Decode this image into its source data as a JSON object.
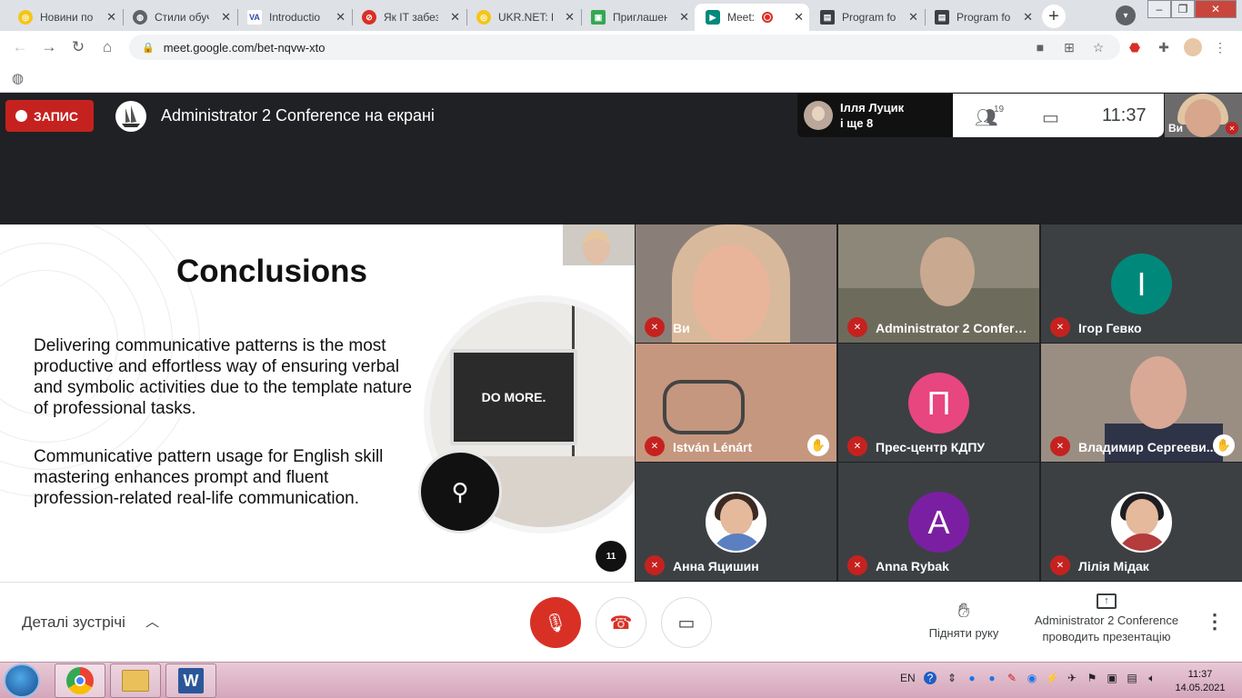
{
  "browser": {
    "tabs": [
      {
        "title": "Новини по",
        "icon": "ukr-net-icon"
      },
      {
        "title": "Стили обуч",
        "icon": "globe-icon"
      },
      {
        "title": "Introductio",
        "icon": "vark-icon"
      },
      {
        "title": "Як ІТ забезп",
        "icon": "opera-icon"
      },
      {
        "title": "UKR.NET: В",
        "icon": "ukr-net-icon"
      },
      {
        "title": "Приглашен",
        "icon": "classroom-icon"
      },
      {
        "title": "Meet: ",
        "icon": "meet-icon",
        "active": true,
        "recording": true
      },
      {
        "title": "Program fo",
        "icon": "document-icon"
      },
      {
        "title": "Program fo",
        "icon": "document-icon"
      }
    ],
    "url": "meet.google.com/bet-nqvw-xto"
  },
  "meet": {
    "record_label": "ЗАПИС",
    "presentation_title": "Administrator 2 Conference на екрані",
    "speaker": {
      "name": "Ілля Луцик",
      "more": "і ще 8"
    },
    "participant_count": "19",
    "time": "11:37",
    "self_label": "Ви"
  },
  "slide": {
    "title": "Conclusions",
    "bullets": [
      "Delivering communicative patterns is the most productive and effortless way of ensuring verbal and symbolic activities due to the template nature of professional tasks.",
      "Communicative pattern usage for English skill mastering enhances prompt and fluent profession-related real-life communication."
    ],
    "screen_text": "DO MORE.",
    "page_number": "11"
  },
  "participants": [
    {
      "name": "Ви",
      "type": "video",
      "muted": true,
      "hand": false
    },
    {
      "name": "Administrator 2 Conferen...",
      "type": "video",
      "muted": true,
      "hand": false
    },
    {
      "name": "Ігор Гевко",
      "type": "initial",
      "initial": "І",
      "color": "#00897b",
      "muted": true,
      "hand": false
    },
    {
      "name": "István Lénárt",
      "type": "video",
      "muted": true,
      "hand": true
    },
    {
      "name": "Прес-центр КДПУ",
      "type": "initial",
      "initial": "П",
      "color": "#e8467f",
      "muted": true,
      "hand": false
    },
    {
      "name": "Владимир Сергееви...",
      "type": "video",
      "muted": true,
      "hand": true
    },
    {
      "name": "Анна Яцишин",
      "type": "photo",
      "muted": true,
      "hand": false
    },
    {
      "name": "Anna Rybak",
      "type": "initial",
      "initial": "A",
      "color": "#7b1fa2",
      "muted": true,
      "hand": false
    },
    {
      "name": "Лілія Мідак",
      "type": "photo",
      "muted": true,
      "hand": false
    }
  ],
  "bottom": {
    "details_label": "Деталі зустрічі",
    "raise_hand_label": "Підняти руку",
    "presenting_label": "Administrator 2 Conference проводить презентацію"
  },
  "taskbar": {
    "lang": "EN",
    "time": "11:37",
    "date": "14.05.2021"
  }
}
